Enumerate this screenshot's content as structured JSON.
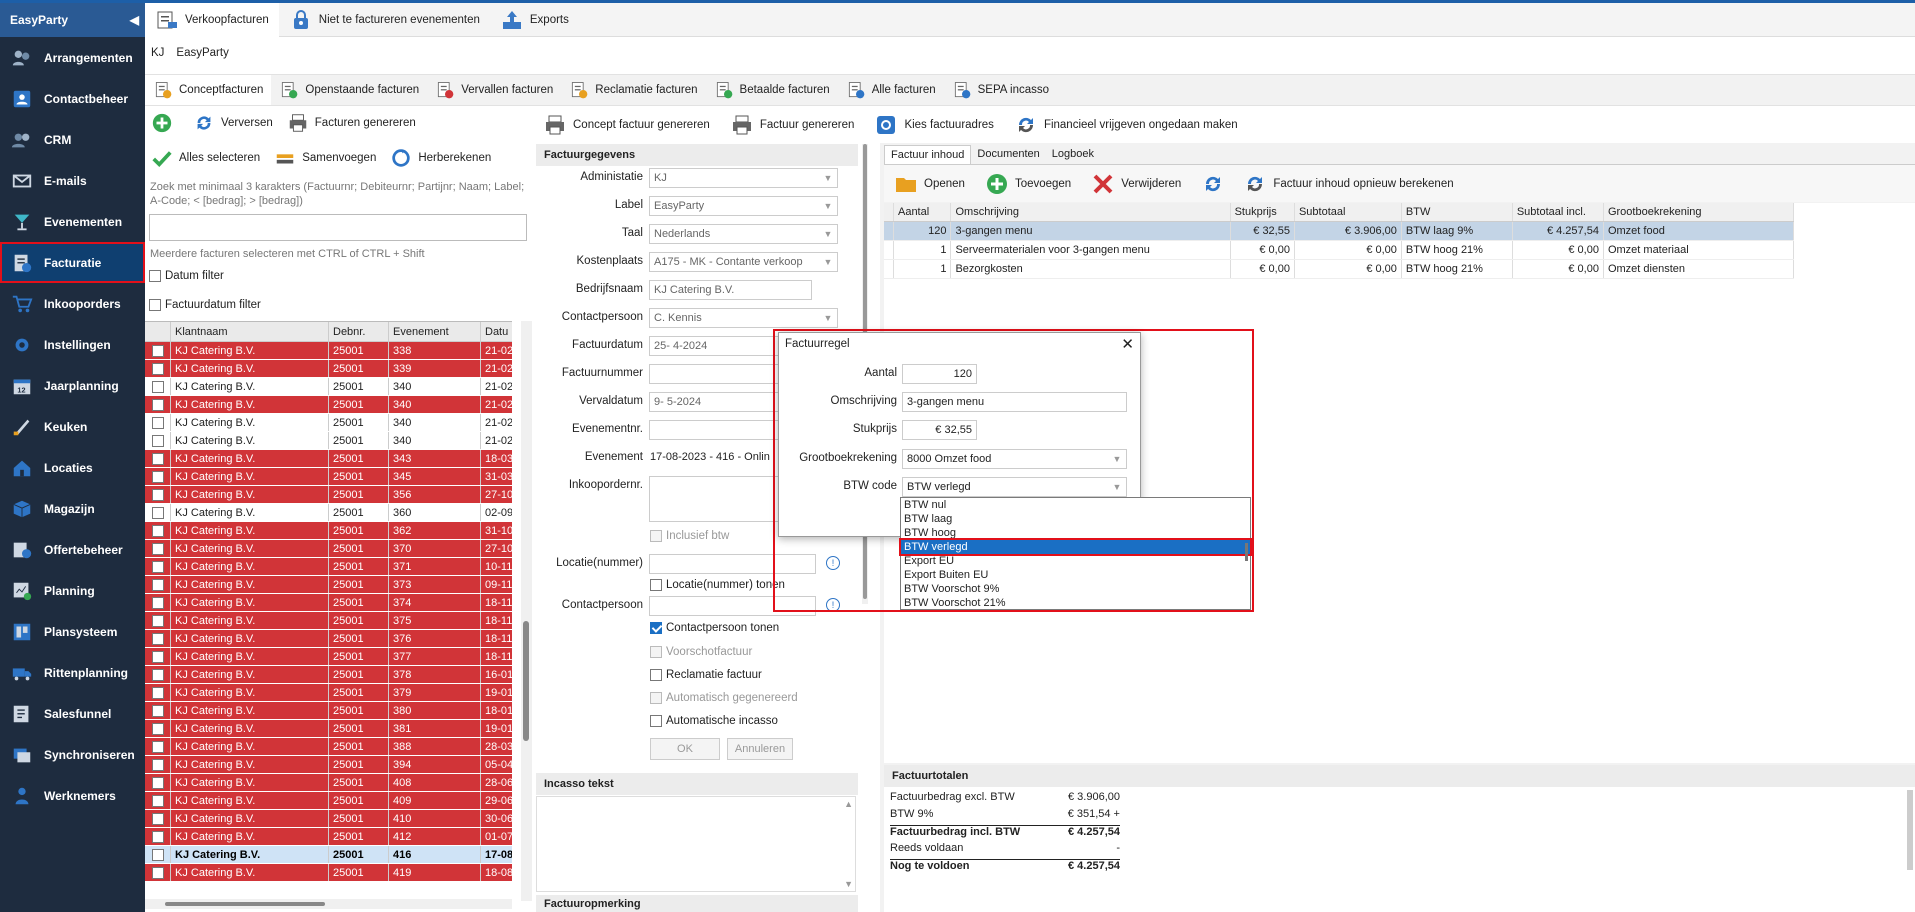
{
  "app": {
    "name": "EasyParty"
  },
  "sidebar": {
    "items": [
      {
        "label": "Arrangementen",
        "icon": "people-icon"
      },
      {
        "label": "Contactbeheer",
        "icon": "contacts-icon"
      },
      {
        "label": "CRM",
        "icon": "crm-icon"
      },
      {
        "label": "E-mails",
        "icon": "mail-icon"
      },
      {
        "label": "Evenementen",
        "icon": "cocktail-icon"
      },
      {
        "label": "Facturatie",
        "icon": "invoice-icon"
      },
      {
        "label": "Inkooporders",
        "icon": "cart-icon"
      },
      {
        "label": "Instellingen",
        "icon": "gear-icon"
      },
      {
        "label": "Jaarplanning",
        "icon": "calendar-icon"
      },
      {
        "label": "Keuken",
        "icon": "knife-icon"
      },
      {
        "label": "Locaties",
        "icon": "house-icon"
      },
      {
        "label": "Magazijn",
        "icon": "box-icon"
      },
      {
        "label": "Offertebeheer",
        "icon": "quote-icon"
      },
      {
        "label": "Planning",
        "icon": "planning-icon"
      },
      {
        "label": "Plansysteem",
        "icon": "board-icon"
      },
      {
        "label": "Rittenplanning",
        "icon": "truck-icon"
      },
      {
        "label": "Salesfunnel",
        "icon": "funnel-icon"
      },
      {
        "label": "Synchroniseren",
        "icon": "sync-icon"
      },
      {
        "label": "Werknemers",
        "icon": "employee-icon"
      }
    ],
    "active": "Facturatie"
  },
  "topbar": {
    "tabs": [
      "Verkoopfacturen",
      "Niet te factureren evenementen",
      "Exports"
    ]
  },
  "crumb": {
    "code": "KJ",
    "label": "EasyParty"
  },
  "tabs2": [
    "Conceptfacturen",
    "Openstaande facturen",
    "Vervallen facturen",
    "Reclamatie facturen",
    "Betaalde facturen",
    "Alle facturen",
    "SEPA incasso"
  ],
  "left": {
    "btn_refresh": "Verversen",
    "btn_generate": "Facturen genereren",
    "btn_select_all": "Alles selecteren",
    "btn_merge": "Samenvoegen",
    "btn_recalc": "Herberekenen",
    "search_hint": "Zoek met minimaal 3 karakters (Factuurnr; Debiteurnr; Partijnr; Naam; Label; A-Code; < [bedrag]; > [bedrag])",
    "multi_hint": "Meerdere facturen selecteren met CTRL of CTRL + Shift",
    "date_filter": "Datum filter",
    "invoice_date_filter": "Factuurdatum filter",
    "columns": [
      "Klantnaam",
      "Debnr.",
      "Evenement",
      "Datu"
    ],
    "rows": [
      [
        "KJ Catering B.V.",
        "25001",
        "338",
        "21-02",
        "red"
      ],
      [
        "KJ Catering B.V.",
        "25001",
        "339",
        "21-02",
        "red"
      ],
      [
        "KJ Catering B.V.",
        "25001",
        "340",
        "21-02",
        "white"
      ],
      [
        "KJ Catering B.V.",
        "25001",
        "340",
        "21-02",
        "red"
      ],
      [
        "KJ Catering B.V.",
        "25001",
        "340",
        "21-02",
        "white"
      ],
      [
        "KJ Catering B.V.",
        "25001",
        "340",
        "21-02",
        "white"
      ],
      [
        "KJ Catering B.V.",
        "25001",
        "343",
        "18-03",
        "red"
      ],
      [
        "KJ Catering B.V.",
        "25001",
        "345",
        "31-03",
        "red"
      ],
      [
        "KJ Catering B.V.",
        "25001",
        "356",
        "27-10",
        "red"
      ],
      [
        "KJ Catering B.V.",
        "25001",
        "360",
        "02-09",
        "white"
      ],
      [
        "KJ Catering B.V.",
        "25001",
        "362",
        "31-10",
        "red"
      ],
      [
        "KJ Catering B.V.",
        "25001",
        "370",
        "27-10",
        "red"
      ],
      [
        "KJ Catering B.V.",
        "25001",
        "371",
        "10-11",
        "red"
      ],
      [
        "KJ Catering B.V.",
        "25001",
        "373",
        "09-11",
        "red"
      ],
      [
        "KJ Catering B.V.",
        "25001",
        "374",
        "18-11",
        "red"
      ],
      [
        "KJ Catering B.V.",
        "25001",
        "375",
        "18-11",
        "red"
      ],
      [
        "KJ Catering B.V.",
        "25001",
        "376",
        "18-11",
        "red"
      ],
      [
        "KJ Catering B.V.",
        "25001",
        "377",
        "18-11",
        "red"
      ],
      [
        "KJ Catering B.V.",
        "25001",
        "378",
        "16-01",
        "red"
      ],
      [
        "KJ Catering B.V.",
        "25001",
        "379",
        "19-01",
        "red"
      ],
      [
        "KJ Catering B.V.",
        "25001",
        "380",
        "18-01",
        "red"
      ],
      [
        "KJ Catering B.V.",
        "25001",
        "381",
        "19-01",
        "red"
      ],
      [
        "KJ Catering B.V.",
        "25001",
        "388",
        "28-03",
        "red"
      ],
      [
        "KJ Catering B.V.",
        "25001",
        "394",
        "05-04",
        "red"
      ],
      [
        "KJ Catering B.V.",
        "25001",
        "408",
        "28-06",
        "red"
      ],
      [
        "KJ Catering B.V.",
        "25001",
        "409",
        "29-06",
        "red"
      ],
      [
        "KJ Catering B.V.",
        "25001",
        "410",
        "30-06",
        "red"
      ],
      [
        "KJ Catering B.V.",
        "25001",
        "412",
        "01-07",
        "red"
      ],
      [
        "KJ Catering B.V.",
        "25001",
        "416",
        "17-08",
        "sel"
      ],
      [
        "KJ Catering B.V.",
        "25001",
        "419",
        "18-08",
        "red"
      ]
    ]
  },
  "mid_tools": [
    "Concept factuur genereren",
    "Factuur genereren",
    "Kies factuuradres",
    "Financieel vrijgeven ongedaan maken"
  ],
  "invoice": {
    "section": "Factuurgegevens",
    "labels": {
      "administratie": "Administatie",
      "label": "Label",
      "taal": "Taal",
      "kostenplaats": "Kostenplaats",
      "bedrijfsnaam": "Bedrijfsnaam",
      "contactpersoon": "Contactpersoon",
      "factuurdatum": "Factuurdatum",
      "factuurnummer": "Factuurnummer",
      "vervaldatum": "Vervaldatum",
      "evenementnr": "Evenementnr.",
      "evenement": "Evenement",
      "inkoopordernr": "Inkoopordernr.",
      "locatie": "Locatie(nummer)",
      "contactpersoon2": "Contactpersoon"
    },
    "values": {
      "administratie": "KJ",
      "label": "EasyParty",
      "taal": "Nederlands",
      "kostenplaats": "A175 - MK - Contante verkoop",
      "bedrijfsnaam": "KJ Catering B.V.",
      "contactpersoon": "C. Kennis",
      "factuurdatum": "25-  4-2024",
      "vervaldatum": "9-  5-2024",
      "evenement": "17-08-2023  -  416 - Onlin"
    },
    "checks": {
      "incl_btw": "Inclusief btw",
      "locatie_tonen": "Locatie(nummer) tonen",
      "contact_tonen": "Contactpersoon tonen",
      "voorschot": "Voorschotfactuur",
      "reclamatie": "Reclamatie factuur",
      "auto_gen": "Automatisch gegenereerd",
      "auto_incasso": "Automatische incasso"
    },
    "ok": "OK",
    "cancel": "Annuleren",
    "incasso_title": "Incasso tekst",
    "remark_title": "Factuuropmerking"
  },
  "right": {
    "tabs": [
      "Factuur inhoud",
      "Documenten",
      "Logboek"
    ],
    "tools": [
      "Openen",
      "Toevoegen",
      "Verwijderen",
      "Factuur inhoud opnieuw berekenen"
    ],
    "columns": [
      "Aantal",
      "Omschrijving",
      "Stukprijs",
      "Subtotaal",
      "BTW",
      "Subtotaal incl.",
      "Grootboekrekening"
    ],
    "rows": [
      [
        "120",
        "3-gangen menu",
        "€ 32,55",
        "€ 3.906,00",
        "BTW laag 9%",
        "€ 4.257,54",
        "Omzet food"
      ],
      [
        "1",
        "Serveermaterialen voor 3-gangen menu",
        "€ 0,00",
        "€ 0,00",
        "BTW hoog 21%",
        "€ 0,00",
        "Omzet materiaal"
      ],
      [
        "1",
        "Bezorgkosten",
        "€ 0,00",
        "€ 0,00",
        "BTW hoog 21%",
        "€ 0,00",
        "Omzet diensten"
      ]
    ],
    "totals_title": "Factuurtotalen",
    "totals": [
      [
        "Factuurbedrag excl. BTW",
        "€ 3.906,00"
      ],
      [
        "BTW 9%",
        "€ 351,54 +"
      ],
      [
        "Factuurbedrag incl. BTW",
        "€ 4.257,54"
      ],
      [
        "Reeds voldaan",
        "-"
      ],
      [
        "Nog te voldoen",
        "€ 4.257,54"
      ]
    ]
  },
  "modal": {
    "title": "Factuurregel",
    "labels": {
      "aantal": "Aantal",
      "omschrijving": "Omschrijving",
      "stukprijs": "Stukprijs",
      "grootboek": "Grootboekrekening",
      "btw": "BTW code"
    },
    "values": {
      "aantal": "120",
      "omschrijving": "3-gangen menu",
      "stukprijs": "€ 32,55",
      "grootboek": "8000 Omzet food",
      "btw": "BTW verlegd"
    },
    "options": [
      "BTW nul",
      "BTW laag",
      "BTW hoog",
      "BTW verlegd",
      "Export EU",
      "Export Buiten EU",
      "BTW Voorschot 9%",
      "BTW Voorschot 21%"
    ],
    "selected_index": 3
  },
  "colors": {
    "sidebar": "#1e2c3f",
    "accent": "#1d5fa8",
    "row_red": "#d13438",
    "highlight": "#e2101a"
  }
}
